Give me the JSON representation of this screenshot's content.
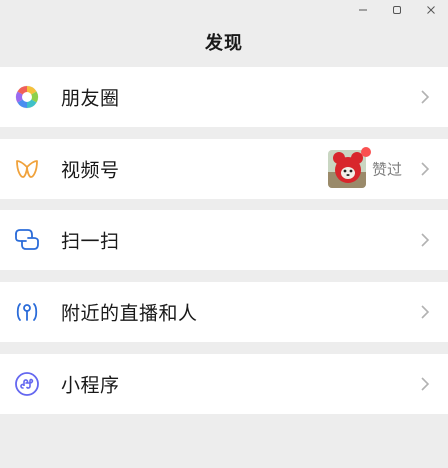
{
  "window": {
    "controls": [
      {
        "name": "minimize",
        "icon": "minimize-icon"
      },
      {
        "name": "maximize",
        "icon": "maximize-icon"
      },
      {
        "name": "close",
        "icon": "close-icon"
      }
    ]
  },
  "header": {
    "title": "发现"
  },
  "menu": {
    "moments": {
      "label": "朋友圈",
      "icon": "moments-aperture-icon"
    },
    "channels": {
      "label": "视频号",
      "icon": "channels-butterfly-icon",
      "thumbnail": "video-thumbnail",
      "badge": "red-dot",
      "status": "赞过"
    },
    "scan": {
      "label": "扫一扫",
      "icon": "scan-icon"
    },
    "nearby": {
      "label": "附近的直播和人",
      "icon": "nearby-location-icon"
    },
    "miniprogram": {
      "label": "小程序",
      "icon": "mini-program-icon"
    }
  },
  "colors": {
    "background": "#ededed",
    "item_bg": "#ffffff",
    "accent_blue": "#2b6cd9",
    "badge_red": "#fa5151",
    "chevron": "#b2b2b2",
    "channels_orange": "#f0a23c",
    "mini_purple": "#6467f0"
  }
}
